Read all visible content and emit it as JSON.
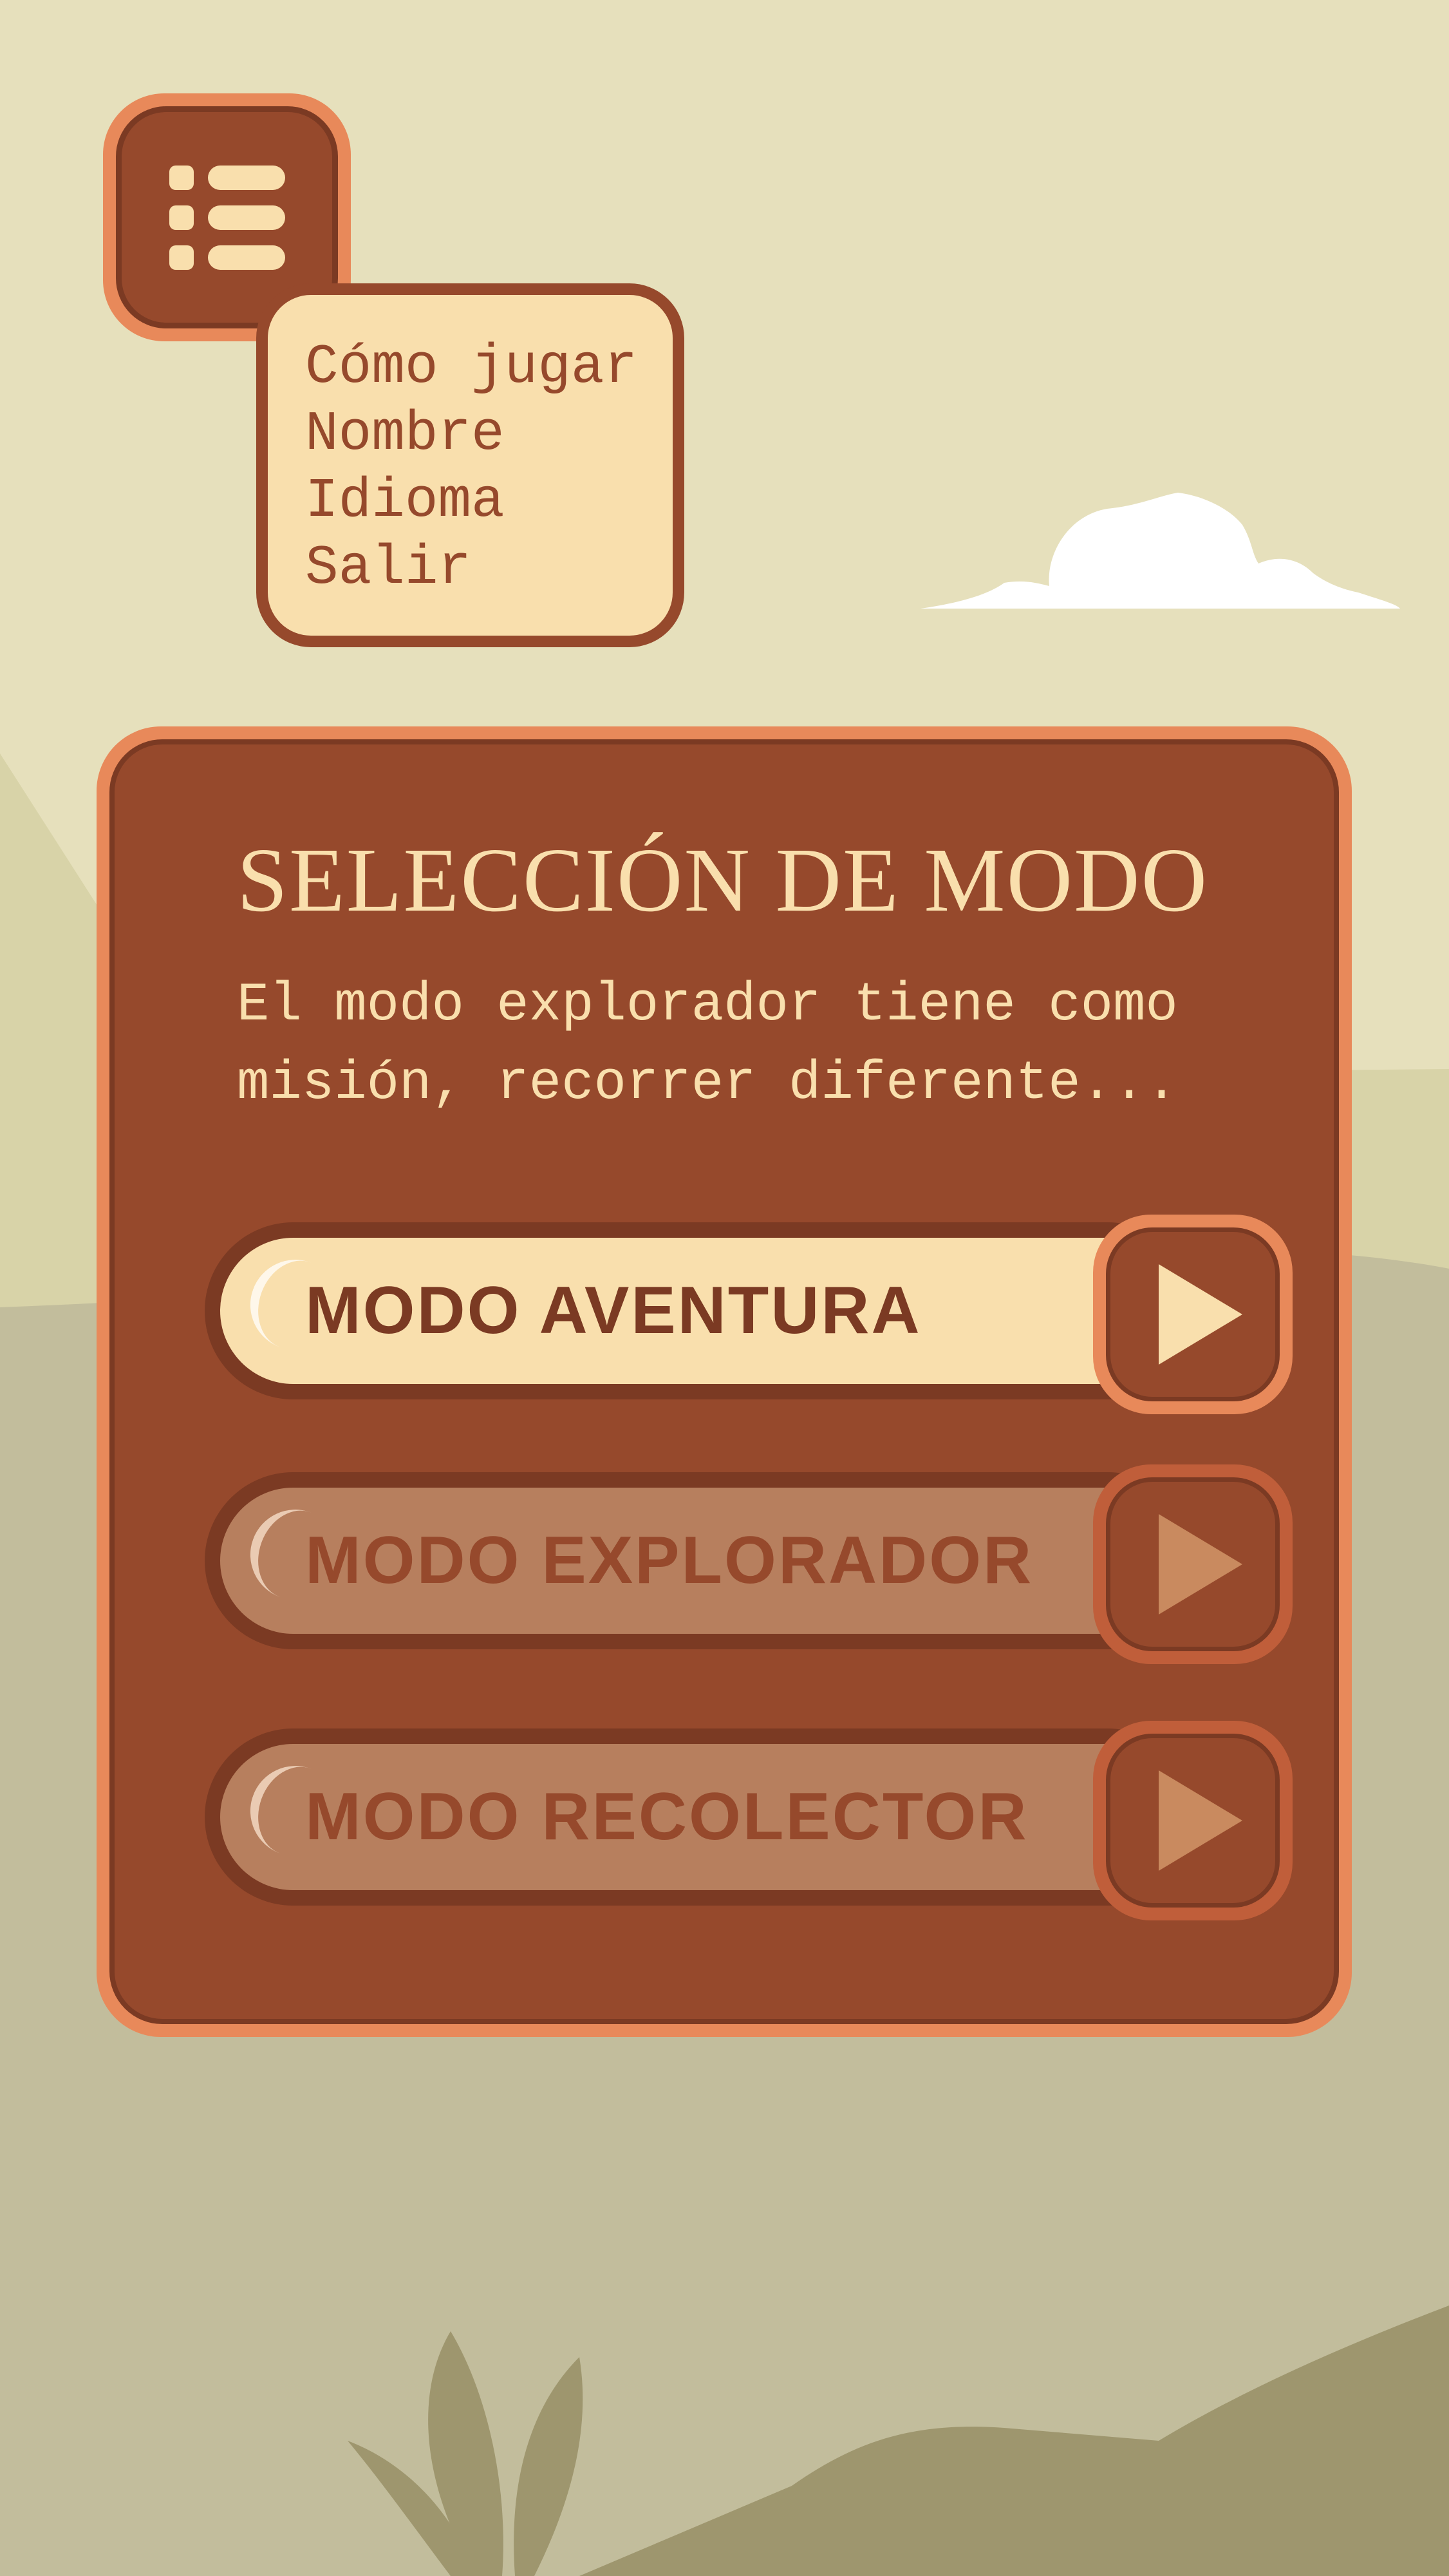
{
  "menu": {
    "icon": "list-menu-icon",
    "items": [
      {
        "label": "Cómo jugar"
      },
      {
        "label": "Nombre"
      },
      {
        "label": "Idioma"
      },
      {
        "label": "Salir"
      }
    ]
  },
  "panel": {
    "title": "SELECCIÓN DE MODO",
    "description": "El modo explorador tiene como misión, recorrer diferente..."
  },
  "modes": [
    {
      "label": "MODO AVENTURA",
      "state": "active",
      "icon": "play-icon"
    },
    {
      "label": "MODO EXPLORADOR",
      "state": "inactive",
      "icon": "play-icon"
    },
    {
      "label": "MODO RECOLECTOR",
      "state": "inactive",
      "icon": "play-icon"
    }
  ],
  "colors": {
    "background": "#e6e0bc",
    "panel": "#96492c",
    "panel_border": "#e8895a",
    "cream": "#f9dfad",
    "dark_brown": "#7b3a23",
    "inactive_pill": "#b77f5e",
    "hill": "#c2bd9c",
    "plant": "#9e966e"
  }
}
